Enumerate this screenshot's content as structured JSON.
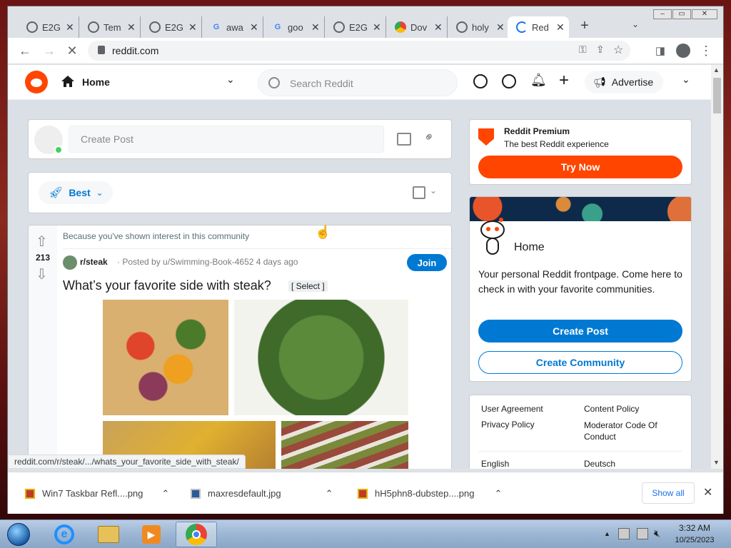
{
  "browser": {
    "tabs": [
      {
        "title": "E2G",
        "icon": "globe-icon"
      },
      {
        "title": "Tem",
        "icon": "globe-icon"
      },
      {
        "title": "E2G",
        "icon": "globe-icon"
      },
      {
        "title": "awa",
        "icon": "google-icon"
      },
      {
        "title": "goo",
        "icon": "google-icon"
      },
      {
        "title": "E2G",
        "icon": "globe-icon"
      },
      {
        "title": "Dov",
        "icon": "chrome-store-icon"
      },
      {
        "title": "holy",
        "icon": "globe-icon"
      },
      {
        "title": "Red",
        "icon": "loading-icon"
      }
    ],
    "new_tab": "+",
    "url": "reddit.com",
    "status_url": "reddit.com/r/steak/.../whats_your_favorite_side_with_steak/"
  },
  "reddit": {
    "nav_home": "Home",
    "search_placeholder": "Search Reddit",
    "advertise": "Advertise",
    "create_post_placeholder": "Create Post",
    "sort_label": "Best",
    "post": {
      "reason": "Because you've shown interest in this community",
      "votes": "213",
      "subreddit": "r/steak",
      "meta": "· Posted by u/Swimming-Book-4652 4 days ago",
      "join": "Join",
      "title": "What’s your favorite side with steak?",
      "select": "[ Select ]"
    },
    "premium": {
      "title": "Reddit Premium",
      "subtitle": "The best Reddit experience",
      "button": "Try Now"
    },
    "home_card": {
      "title": "Home",
      "description": "Your personal Reddit frontpage. Come here to check in with your favorite communities.",
      "create_post": "Create Post",
      "create_community": "Create Community"
    },
    "footer_links": {
      "user_agreement": "User Agreement",
      "content_policy": "Content Policy",
      "privacy_policy": "Privacy Policy",
      "moderator_code": "Moderator Code Of Conduct",
      "english": "English",
      "deutsch": "Deutsch"
    }
  },
  "downloads": {
    "items": [
      "Win7 Taskbar Refl....png",
      "maxresdefault.jpg",
      "hH5phn8-dubstep....png"
    ],
    "show_all": "Show all"
  },
  "taskbar": {
    "time": "3:32 AM",
    "date": "10/25/2023"
  },
  "colors": {
    "reddit_orange": "#ff4500",
    "reddit_blue": "#0079d3"
  }
}
